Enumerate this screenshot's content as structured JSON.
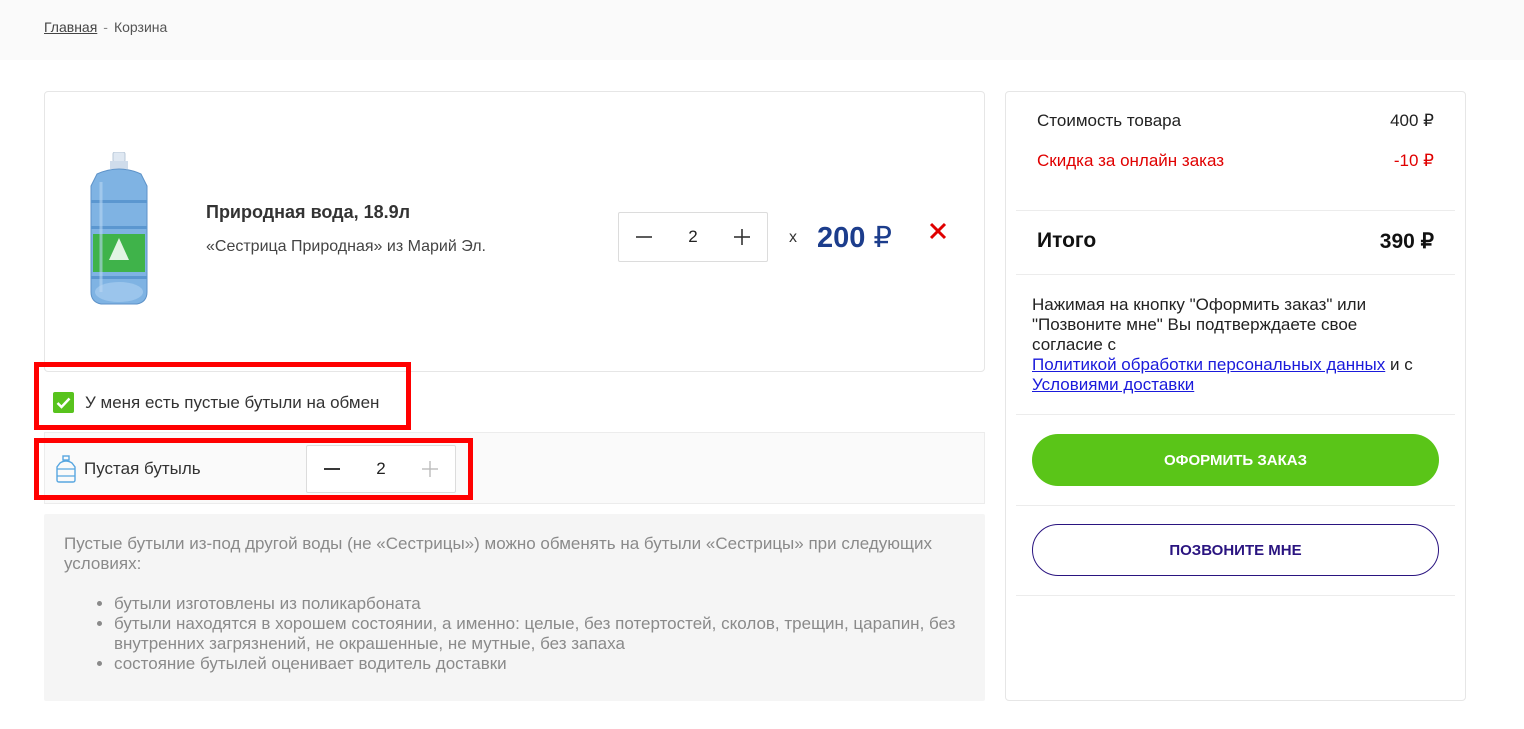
{
  "breadcrumb": {
    "home": "Главная",
    "separator": "-",
    "current": "Корзина"
  },
  "cart_item": {
    "name": "Природная вода, 18.9л",
    "description": "«Сестрица Природная» из Марий Эл.",
    "quantity": "2",
    "multiplier": "x",
    "price": "200",
    "currency": "₽",
    "remove_icon": "close-icon",
    "color_price": "#1c3d8c",
    "color_remove": "#e00000"
  },
  "exchange": {
    "checked": true,
    "label": "У меня есть пустые бутыли на обмен",
    "empty_bottle_label": "Пустая бутыль",
    "empty_bottle_qty": "2"
  },
  "conditions": {
    "intro": "Пустые бутыли из-под другой воды (не «Сестрицы») можно обменять на бутыли «Сестрицы» при следующих условиях:",
    "items": [
      "бутыли изготовлены из поликарбоната",
      "бутыли находятся в хорошем состоянии, а именно: целые, без потертостей, сколов, трещин, царапин, без внутренних загрязнений, не окрашенные, не мутные, без запаха",
      "состояние бутылей оценивает водитель доставки"
    ]
  },
  "summary": {
    "cost_label": "Стоимость товара",
    "cost_value": "400 ₽",
    "discount_label": "Скидка за онлайн заказ",
    "discount_value": "-10 ₽",
    "total_label": "Итого",
    "total_value": "390 ₽",
    "consent_text": "Нажимая на кнопку \"Оформить заказ\" или \"Позвоните мне\" Вы подтверждаете свое согласие с",
    "privacy_link": "Политикой обработки персональных данных",
    "and_text": "и с",
    "delivery_link": "Условиями доставки",
    "order_button": "ОФОРМИТЬ ЗАКАЗ",
    "call_button": "ПОЗВОНИТЕ МНЕ",
    "color_order_button": "#5ac518",
    "color_call_button": "#2a1480"
  }
}
